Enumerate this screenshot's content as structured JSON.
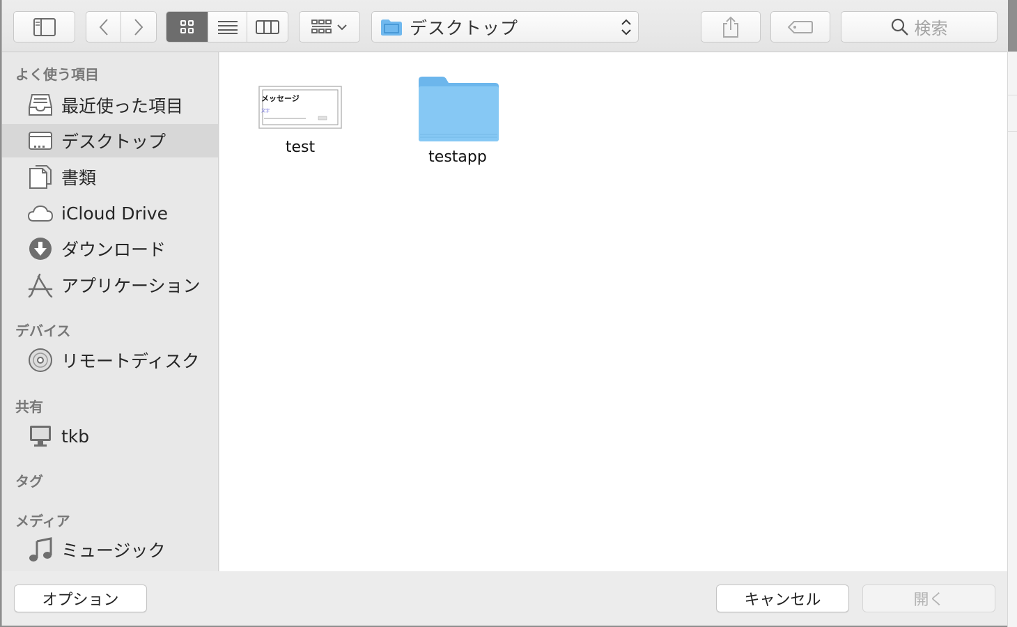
{
  "toolbar": {
    "path_label": "デスクトップ",
    "search_placeholder": "検索"
  },
  "sidebar": {
    "sections": {
      "favorites": "よく使う項目",
      "devices": "デバイス",
      "shared": "共有",
      "tags": "タグ",
      "media": "メディア"
    },
    "favorites": [
      {
        "label": "最近使った項目",
        "icon": "recents-icon"
      },
      {
        "label": "デスクトップ",
        "icon": "desktop-icon",
        "selected": true
      },
      {
        "label": "書類",
        "icon": "documents-icon"
      },
      {
        "label": "iCloud Drive",
        "icon": "icloud-icon"
      },
      {
        "label": "ダウンロード",
        "icon": "downloads-icon"
      },
      {
        "label": "アプリケーション",
        "icon": "applications-icon"
      }
    ],
    "devices": [
      {
        "label": "リモートディスク",
        "icon": "disc-icon"
      }
    ],
    "shared": [
      {
        "label": "tkb",
        "icon": "computer-icon"
      }
    ],
    "media": [
      {
        "label": "ミュージック",
        "icon": "music-icon"
      }
    ]
  },
  "files": [
    {
      "name": "test",
      "type": "document",
      "thumb_title": "メッセージ",
      "thumb_sub": "文字"
    },
    {
      "name": "testapp",
      "type": "folder"
    }
  ],
  "buttons": {
    "options": "オプション",
    "cancel": "キャンセル",
    "open": "開く"
  },
  "colors": {
    "folder_blue": "#7ec3f2",
    "selected_bg": "#d7d7d7",
    "active_view": "#6d6d6d"
  }
}
